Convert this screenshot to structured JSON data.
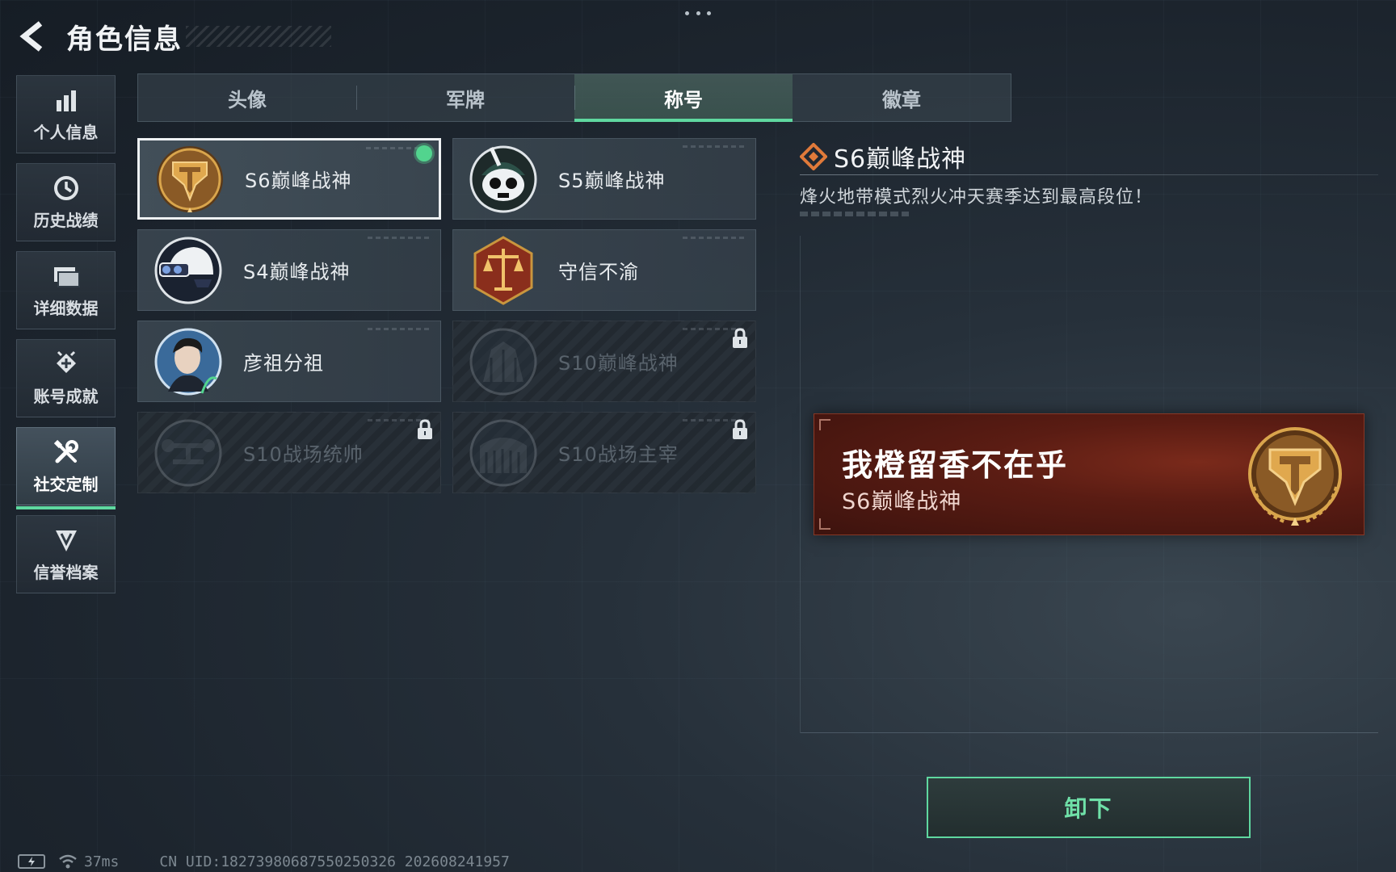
{
  "header": {
    "title": "角色信息",
    "back_icon": "back-arrow-icon"
  },
  "sidebar": {
    "items": [
      {
        "label": "个人信息",
        "icon": "bar-chart-icon",
        "active": false
      },
      {
        "label": "历史战绩",
        "icon": "history-clock-icon",
        "active": false
      },
      {
        "label": "详细数据",
        "icon": "folder-icon",
        "active": false
      },
      {
        "label": "账号成就",
        "icon": "achievement-icon",
        "active": false
      },
      {
        "label": "社交定制",
        "icon": "wrench-tools-icon",
        "active": true
      },
      {
        "label": "信誉档案",
        "icon": "credit-shield-icon",
        "active": false
      }
    ]
  },
  "tabs": [
    {
      "label": "头像",
      "active": false
    },
    {
      "label": "军牌",
      "active": false
    },
    {
      "label": "称号",
      "active": true
    },
    {
      "label": "徽章",
      "active": false
    }
  ],
  "cards": [
    {
      "label": "S6巅峰战神",
      "badge": "s6-shield-badge-icon",
      "state": "equipped"
    },
    {
      "label": "S5巅峰战神",
      "badge": "skull-helmet-badge-icon",
      "state": "unlocked"
    },
    {
      "label": "S4巅峰战神",
      "badge": "night-vision-helmet-badge-icon",
      "state": "unlocked"
    },
    {
      "label": "守信不渝",
      "badge": "scales-badge-icon",
      "state": "unlocked"
    },
    {
      "label": "彦祖分祖",
      "badge": "portrait-badge-icon",
      "state": "unlocked"
    },
    {
      "label": "S10巅峰战神",
      "badge": "building-badge-icon",
      "state": "locked"
    },
    {
      "label": "S10战场统帅",
      "badge": "drone-badge-icon",
      "state": "locked"
    },
    {
      "label": "S10战场主宰",
      "badge": "colosseum-badge-icon",
      "state": "locked"
    }
  ],
  "detail": {
    "title": "S6巅峰战神",
    "description": "烽火地带模式烈火冲天赛季达到最高段位！"
  },
  "nameplate": {
    "player_name": "我橙留香不在乎",
    "title": "S6巅峰战神"
  },
  "actions": {
    "unequip_label": "卸下"
  },
  "status": {
    "ping": "37ms",
    "uid": "CN UID:18273980687550250326 202608241957"
  },
  "colors": {
    "accent": "#5fd8a0",
    "nameplate_bg": "#5a1c13",
    "gold": "#c9963e"
  }
}
